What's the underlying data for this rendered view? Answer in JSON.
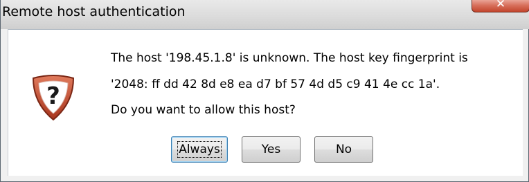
{
  "window": {
    "title": "Remote host authentication",
    "close_icon": "close-icon"
  },
  "icon": {
    "name": "question-icon",
    "glyph": "?",
    "color": "#b5442d"
  },
  "message": {
    "line1": "The host '198.45.1.8' is unknown. The host key fingerprint is",
    "line2": "'2048: ff dd 42 8d e8 ea d7 bf 57 4d d5 c9 41 4e cc 1a'.",
    "line3": "Do you want to allow this host?"
  },
  "buttons": {
    "always": "Always",
    "yes": "Yes",
    "no": "No"
  }
}
